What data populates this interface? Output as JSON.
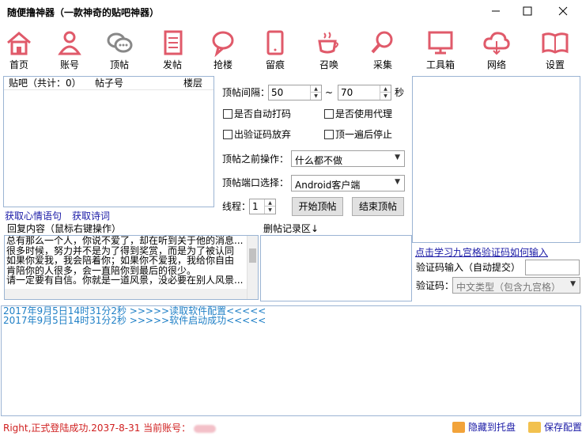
{
  "window": {
    "title": "随便撸神器（一款神奇的贴吧神器）",
    "controls": [
      "minimize",
      "maximize",
      "close"
    ]
  },
  "toolbar": {
    "accent": "#e05a6a",
    "items": [
      {
        "label": "首页",
        "icon": "home-icon"
      },
      {
        "label": "账号",
        "icon": "user-icon"
      },
      {
        "label": "顶帖",
        "icon": "chat-bubbles-icon"
      },
      {
        "label": "发帖",
        "icon": "document-icon"
      },
      {
        "label": "抢楼",
        "icon": "speech-bubble-icon"
      },
      {
        "label": "留痕",
        "icon": "tablet-icon"
      },
      {
        "label": "召唤",
        "icon": "coffee-cup-icon"
      },
      {
        "label": "采集",
        "icon": "magnifier-icon"
      },
      {
        "label": "工具箱",
        "icon": "monitor-icon"
      },
      {
        "label": "网络",
        "icon": "cloud-icon"
      },
      {
        "label": "设置",
        "icon": "book-icon"
      }
    ]
  },
  "post_table": {
    "columns": [
      "贴吧（共计：0）",
      "帖子号",
      "楼层"
    ],
    "rows": []
  },
  "links": {
    "mood_quotes": "获取心情语句",
    "poems": "获取诗词"
  },
  "settings": {
    "interval_label": "顶帖间隔：",
    "interval_min": "50",
    "interval_sep": "~",
    "interval_max": "70",
    "interval_unit": "秒",
    "auto_captcha": "是否自动打码",
    "use_proxy": "是否使用代理",
    "skip_captcha": "出验证码放弃",
    "stop_after_one": "顶一遍后停止",
    "before_label": "顶帖之前操作：",
    "before_value": "什么都不做",
    "client_label": "顶帖端口选择：",
    "client_value": "Android客户端",
    "threads_label": "线程：",
    "threads_value": "1",
    "start_button": "开始顶帖",
    "stop_button": "结束顶帖"
  },
  "reply": {
    "header": "回复内容（鼠标右键操作）",
    "lines": [
      "总有那么一个人，你说不爱了，却在听到关于他的消息...",
      "很多时候，努力并不是为了得到奖赏，而是为了被认同",
      "如果你爱我，我会陪着你；如果你不爱我，我给你自由",
      "肯陪你的人很多，会一直陪你到最后的很少。",
      "请一定要有自信。你就是一道风景，没必要在别人风景..."
    ]
  },
  "delete_log": {
    "header": "删帖记录区↓"
  },
  "captcha": {
    "learn_link": "点击学习九宫格验证码如何输入",
    "input_label": "验证码输入（自动提交）",
    "input_value": "",
    "type_label": "验证码：",
    "type_value": "中文类型（包含九宫格）"
  },
  "log": {
    "entries": [
      "2017年9月5日14时31分2秒 >>>>>读取软件配置<<<<<",
      "2017年9月5日14时31分2秒 >>>>>软件启动成功<<<<<"
    ]
  },
  "status": {
    "message": "Right,正式登陆成功.2037-8-31 当前账号：",
    "hide_tray": "隐藏到托盘",
    "save_config": "保存配置"
  }
}
